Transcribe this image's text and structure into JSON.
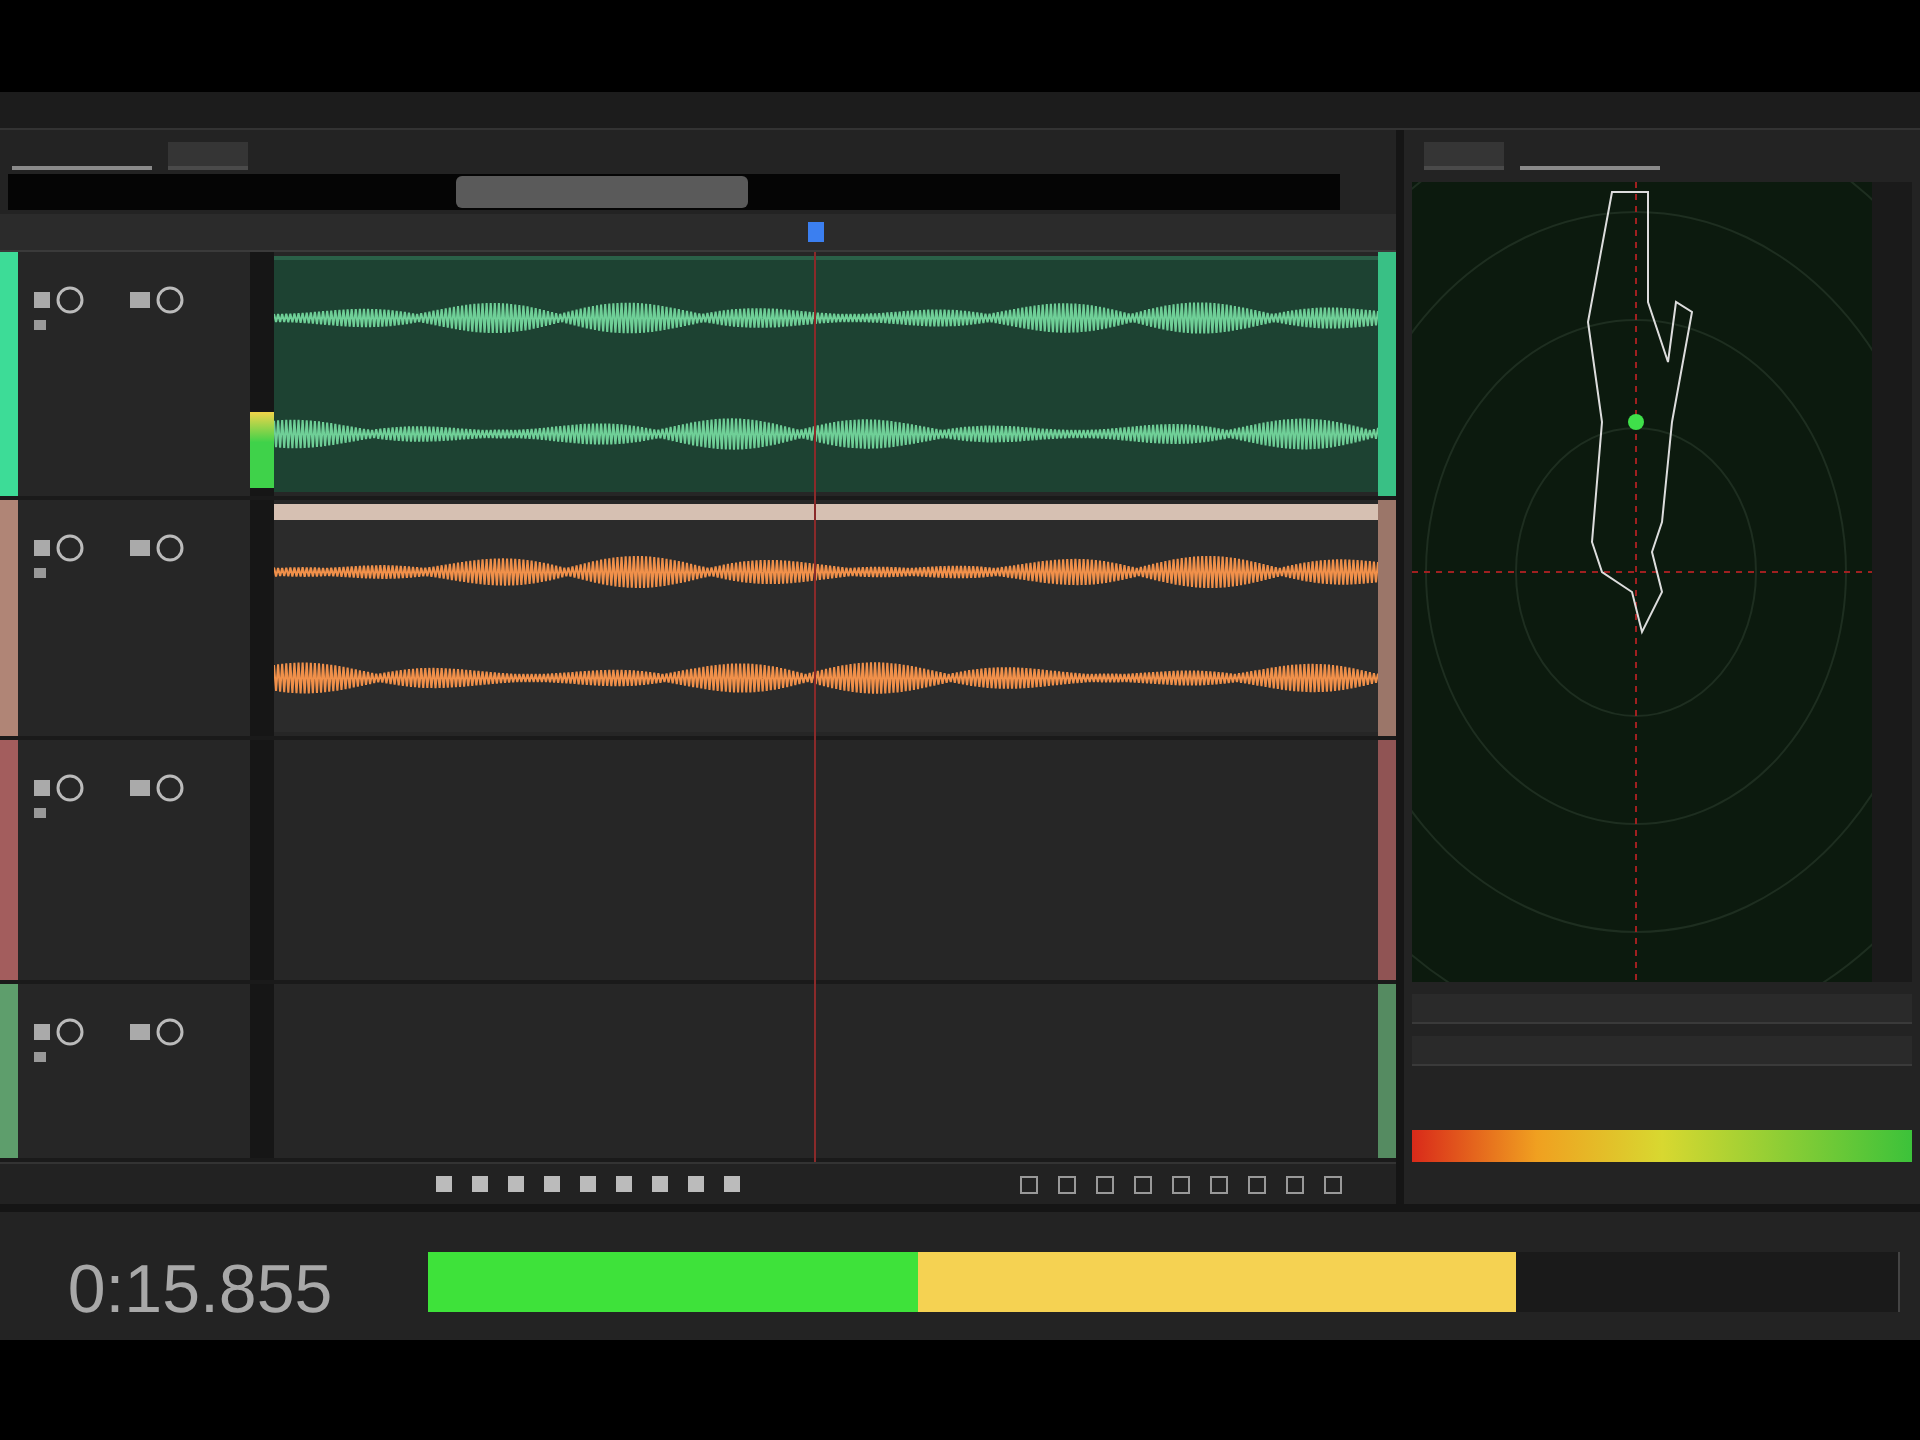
{
  "tracks": [
    {
      "color": "#3ddc97",
      "kind": "clip",
      "clip": {
        "color": "#6fcf97"
      },
      "meter": {
        "level": 0.32
      }
    },
    {
      "color": "#b08576",
      "kind": "clip",
      "clip": {
        "color": "#f0904a"
      }
    },
    {
      "color": "#a35d5d",
      "kind": "empty"
    },
    {
      "color": "#5e9e6c",
      "kind": "empty"
    }
  ],
  "time_display": {
    "value": "0:15.855"
  },
  "master_meter": {
    "level": 0.74
  }
}
